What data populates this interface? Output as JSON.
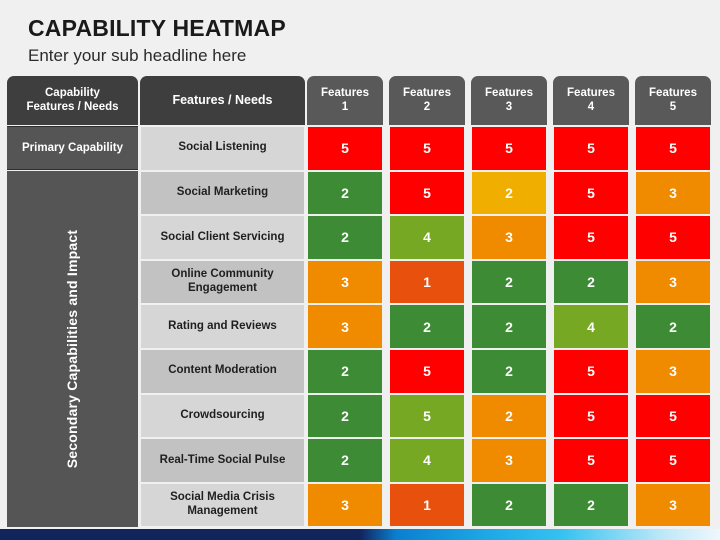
{
  "title": "CAPABILITY HEATMAP",
  "subtitle": "Enter your sub headline here",
  "header": {
    "capability_col": "Capability\nFeatures / Needs",
    "capability_col_line1": "Capability",
    "capability_col_line2": "Features / Needs",
    "features_needs_col": "Features / Needs",
    "feature_columns": [
      {
        "name": "Features",
        "number": "1",
        "full": "Features 1"
      },
      {
        "name": "Features",
        "number": "2",
        "full": "Features 2"
      },
      {
        "name": "Features",
        "number": "3",
        "full": "Features 3"
      },
      {
        "name": "Features",
        "number": "4",
        "full": "Features 4"
      },
      {
        "name": "Features",
        "number": "5",
        "full": "Features 5"
      }
    ]
  },
  "categories": {
    "primary": "Primary Capability",
    "secondary": "Secondary Capabilities and Impact"
  },
  "rows": [
    {
      "label": "Social Listening",
      "values": [
        "5",
        "5",
        "5",
        "5",
        "5"
      ]
    },
    {
      "label": "Social Marketing",
      "values": [
        "2",
        "5",
        "2",
        "5",
        "3"
      ]
    },
    {
      "label": "Social Client Servicing",
      "values": [
        "2",
        "4",
        "3",
        "5",
        "5"
      ]
    },
    {
      "label": "Online Community Engagement",
      "values": [
        "3",
        "1",
        "2",
        "2",
        "3"
      ]
    },
    {
      "label": "Rating and Reviews",
      "values": [
        "3",
        "2",
        "2",
        "4",
        "2"
      ]
    },
    {
      "label": "Content Moderation",
      "values": [
        "2",
        "5",
        "2",
        "5",
        "3"
      ]
    },
    {
      "label": "Crowdsourcing",
      "values": [
        "2",
        "5",
        "2",
        "5",
        "5"
      ]
    },
    {
      "label": "Real-Time Social Pulse",
      "values": [
        "2",
        "4",
        "3",
        "5",
        "5"
      ]
    },
    {
      "label": "Social Media Crisis Management",
      "values": [
        "3",
        "1",
        "2",
        "2",
        "3"
      ]
    }
  ],
  "cell_colors": {
    "row0": [
      "#fe0000",
      "#fe0000",
      "#fe0000",
      "#fe0000",
      "#fe0000"
    ],
    "row1": [
      "#3d8b35",
      "#fe0000",
      "#efae00",
      "#fe0000",
      "#f08b00"
    ],
    "row2": [
      "#3d8b35",
      "#76a823",
      "#f08b00",
      "#fe0000",
      "#fe0000"
    ],
    "row3": [
      "#f08b00",
      "#e8500e",
      "#3d8b35",
      "#3d8b35",
      "#f08b00"
    ],
    "row4": [
      "#f08b00",
      "#3d8b35",
      "#3d8b35",
      "#76a823",
      "#3d8b35"
    ],
    "row5": [
      "#3d8b35",
      "#fe0000",
      "#3d8b35",
      "#fe0000",
      "#f08b00"
    ],
    "row6": [
      "#3d8b35",
      "#76a823",
      "#f08b00",
      "#fe0000",
      "#fe0000"
    ],
    "row7": [
      "#3d8b35",
      "#76a823",
      "#f08b00",
      "#fe0000",
      "#fe0000"
    ],
    "row8": [
      "#f08b00",
      "#e8500e",
      "#3d8b35",
      "#3d8b35",
      "#f08b00"
    ]
  },
  "palette": {
    "red": "#fe0000",
    "dark_orange": "#e8500e",
    "orange": "#f08b00",
    "amber": "#efae00",
    "olive_green": "#76a823",
    "green": "#3d8b35",
    "header_dark": "#3e3e3e",
    "header_mid": "#595959",
    "category_gray": "#555555",
    "label_light": "#d6d6d6",
    "label_dark": "#c2c2c2",
    "background": "#f0f0f0",
    "strip_navy": "#11245c",
    "strip_cyan": "#35c2f0"
  },
  "chart_data": {
    "type": "heatmap",
    "title": "CAPABILITY HEATMAP",
    "subtitle": "Enter your sub headline here",
    "xlabel": "Features / Needs",
    "ylabel": "Capability Features / Needs",
    "x_categories": [
      "Features 1",
      "Features 2",
      "Features 3",
      "Features 4",
      "Features 5"
    ],
    "y_categories": [
      "Social Listening",
      "Social Marketing",
      "Social Client Servicing",
      "Online Community Engagement",
      "Rating and Reviews",
      "Content Moderation",
      "Crowdsourcing",
      "Real-Time Social Pulse",
      "Social Media Crisis Management"
    ],
    "y_groups": [
      {
        "name": "Primary Capability",
        "rows": [
          "Social Listening"
        ]
      },
      {
        "name": "Secondary Capabilities and Impact",
        "rows": [
          "Social Marketing",
          "Social Client Servicing",
          "Online Community Engagement",
          "Rating and Reviews",
          "Content Moderation",
          "Crowdsourcing",
          "Real-Time Social Pulse",
          "Social Media Crisis Management"
        ]
      }
    ],
    "values": [
      [
        5,
        5,
        5,
        5,
        5
      ],
      [
        2,
        5,
        2,
        5,
        3
      ],
      [
        2,
        4,
        3,
        5,
        5
      ],
      [
        3,
        1,
        2,
        2,
        3
      ],
      [
        3,
        2,
        2,
        4,
        2
      ],
      [
        2,
        5,
        2,
        5,
        3
      ],
      [
        2,
        5,
        2,
        5,
        5
      ],
      [
        2,
        4,
        3,
        5,
        5
      ],
      [
        3,
        1,
        2,
        2,
        3
      ]
    ],
    "value_range": [
      1,
      5
    ],
    "grid": true,
    "legend": "none"
  }
}
